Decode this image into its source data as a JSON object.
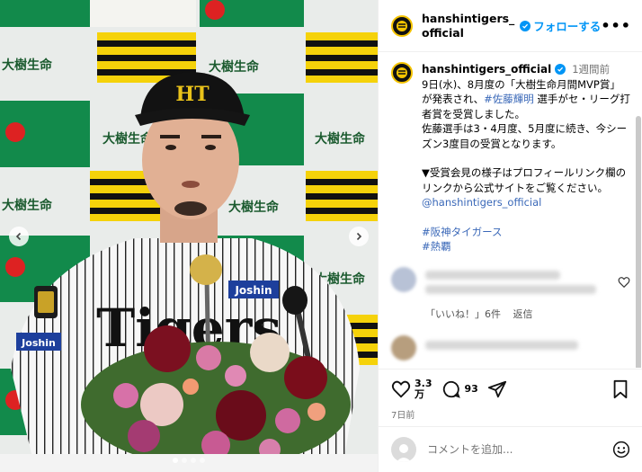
{
  "media": {
    "backdrop_text": "大樹生命",
    "jersey_text": "Tigers",
    "sponsor_text": "Joshin",
    "cap_text": "HT"
  },
  "header": {
    "username": "hanshintigers_official",
    "follow_label": "フォローする",
    "more_label": "•••"
  },
  "caption": {
    "username": "hanshintigers_official",
    "time": "1週間前",
    "line1_a": "9日(水)、8月度の「大樹生命月間MVP賞」が発表され、",
    "mention_tag": "#佐藤輝明",
    "line1_b": " 選手がセ・リーグ打者賞を受賞しました。",
    "line2": "佐藤選手は3・4月度、5月度に続き、今シーズン3度目の受賞となります。",
    "line3": "▼受賞会見の様子はプロフィールリンク欄のリンクから公式サイトをご覧ください。",
    "mention": "@hanshintigers_official",
    "hashtag1": "#阪神タイガース",
    "hashtag2": "#熱覇"
  },
  "comments": {
    "likes_label": "「いいね！」6件",
    "reply_label": "返信"
  },
  "actions": {
    "like_count_line1": "3.3",
    "like_count_line2": "万",
    "comment_count": "93",
    "posted": "7日前"
  },
  "comment_bar": {
    "placeholder": "コメントを追加..."
  },
  "colors": {
    "accent": "#0095f6",
    "link": "#3a68b8",
    "backdrop_green": "#128a4b",
    "tiger_yellow": "#f5d20a"
  }
}
